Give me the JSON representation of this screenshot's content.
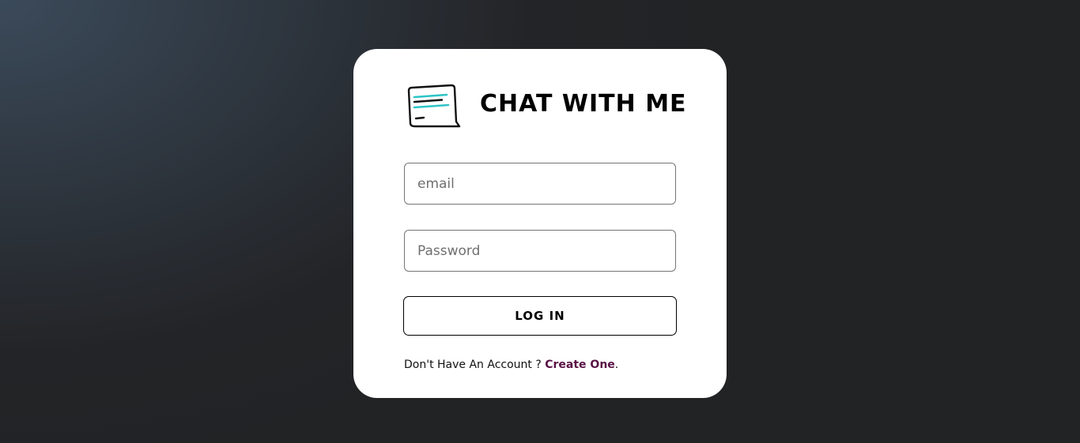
{
  "app": {
    "title": "CHAT WITH ME",
    "logo_icon": "chat-bubble-icon",
    "accent_color": "#2ec4c6",
    "link_color": "#5a1346"
  },
  "login_form": {
    "email_placeholder": "email",
    "password_placeholder": "Password",
    "login_label": "LOG IN"
  },
  "signup": {
    "prompt": "Don't Have An Account ? ",
    "link_label": "Create One",
    "suffix": "."
  }
}
